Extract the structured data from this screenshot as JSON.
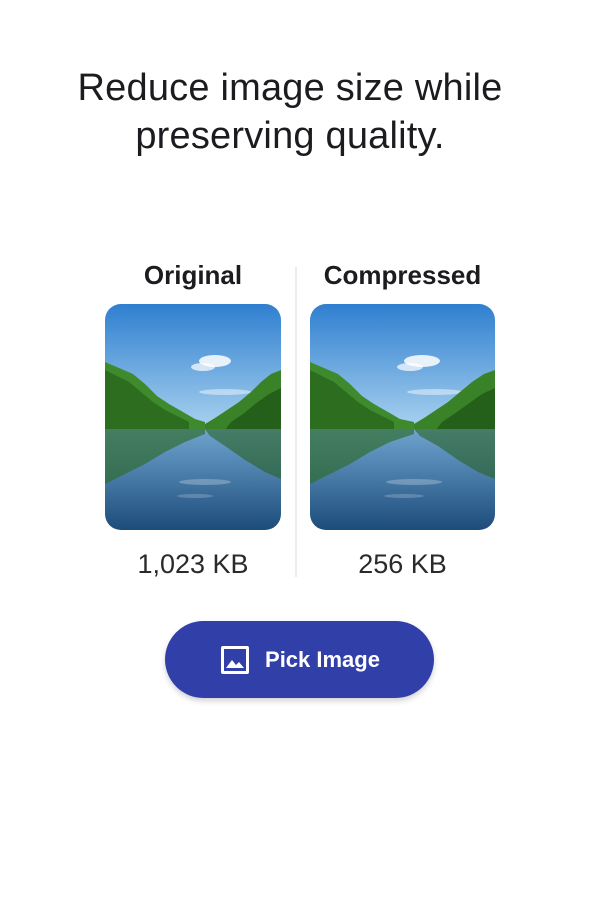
{
  "headline": "Reduce image size while preserving quality.",
  "comparison": {
    "original": {
      "label": "Original",
      "size": "1,023 KB",
      "image": "lake-landscape-photo"
    },
    "compressed": {
      "label": "Compressed",
      "size": "256 KB",
      "image": "lake-landscape-photo"
    }
  },
  "pick_button": {
    "label": "Pick Image",
    "icon": "image-icon",
    "color": "#3040a8"
  }
}
